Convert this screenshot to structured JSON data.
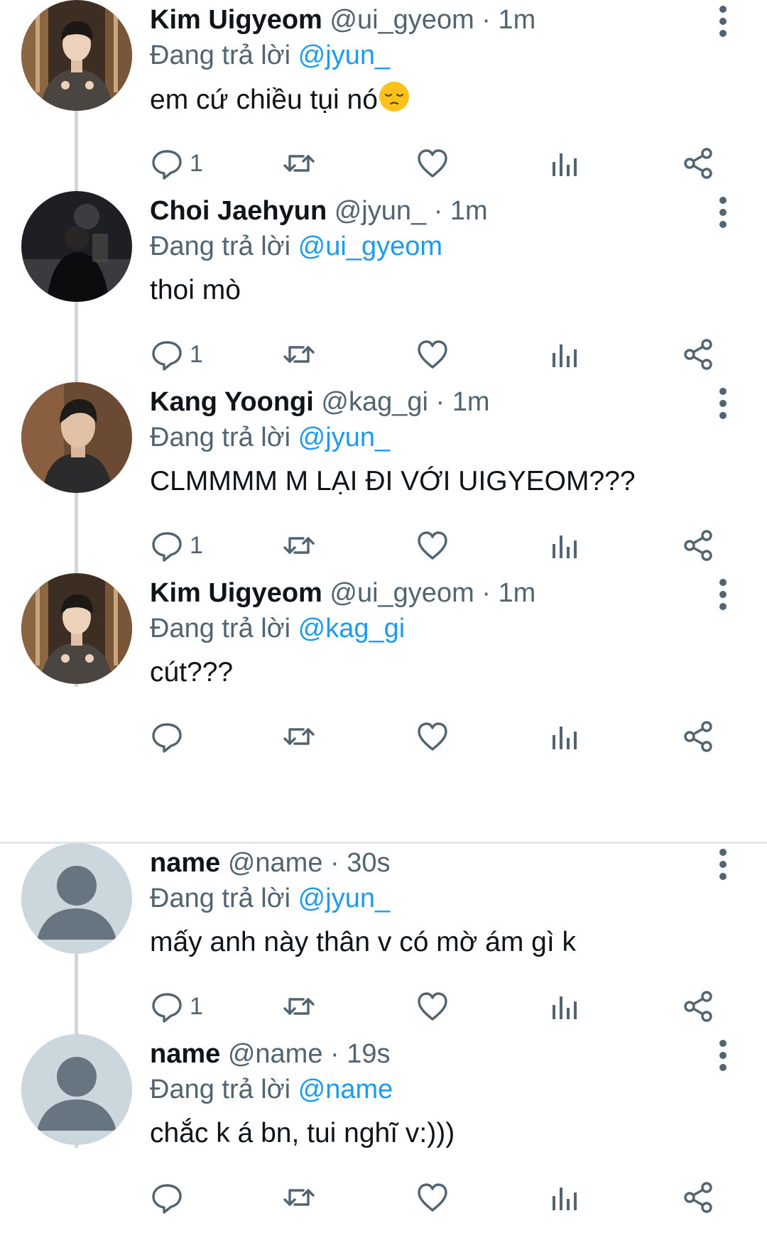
{
  "colors": {
    "text": "#0f1419",
    "secondary": "#536471",
    "accent": "#1d9bf0",
    "thread_line": "#d0d6da",
    "divider": "#e3e6e9"
  },
  "reply_prefix": "Đang trả lời",
  "tweets": [
    {
      "name": "Kim Uigyeom",
      "handle": "@ui_gyeom",
      "sep": "·",
      "time": "1m",
      "reply_to": "@jyun_",
      "text": "em cứ chiều tụi nó",
      "emoji": "pensive-face",
      "reply_count": "1",
      "avatar": "photo-kim-uigyeom"
    },
    {
      "name": "Choi Jaehyun",
      "handle": "@jyun_",
      "sep": "·",
      "time": "1m",
      "reply_to": "@ui_gyeom",
      "text": "thoi mò",
      "reply_count": "1",
      "avatar": "photo-choi-jaehyun"
    },
    {
      "name": "Kang Yoongi",
      "handle": "@kag_gi",
      "sep": "·",
      "time": "1m",
      "reply_to": "@jyun_",
      "text": "CLMMMM M LẠI ĐI VỚI UIGYEOM???",
      "reply_count": "1",
      "avatar": "photo-kang-yoongi"
    },
    {
      "name": "Kim Uigyeom",
      "handle": "@ui_gyeom",
      "sep": "·",
      "time": "1m",
      "reply_to": "@kag_gi",
      "text": "cút???",
      "reply_count": "",
      "avatar": "photo-kim-uigyeom"
    },
    {
      "name": "name",
      "handle": "@name",
      "sep": "·",
      "time": "30s",
      "reply_to": "@jyun_",
      "text": "mấy anh này thân v có mờ ám gì k",
      "reply_count": "1",
      "avatar": "default-avatar"
    },
    {
      "name": "name",
      "handle": "@name",
      "sep": "·",
      "time": "19s",
      "reply_to": "@name",
      "text": "chắc k á bn, tui nghĩ v:)))",
      "reply_count": "",
      "avatar": "default-avatar"
    }
  ]
}
